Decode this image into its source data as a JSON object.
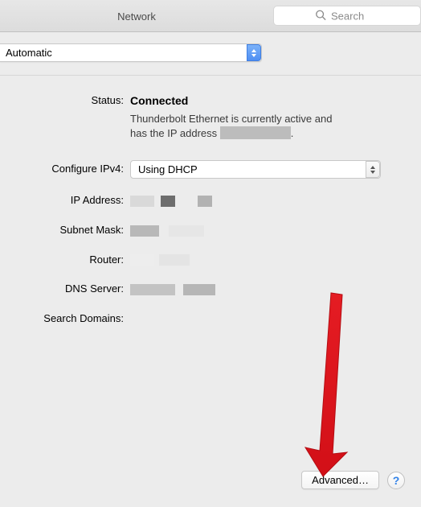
{
  "window": {
    "title": "Network",
    "search": {
      "placeholder": "Search"
    }
  },
  "location": {
    "value": "Automatic"
  },
  "details": {
    "status": {
      "label": "Status:",
      "value": "Connected",
      "desc_line1": "Thunderbolt Ethernet is currently active and",
      "desc_line2_prefix": "has the IP address ",
      "desc_line2_suffix": "."
    },
    "configure_ipv4": {
      "label": "Configure IPv4:",
      "value": "Using DHCP"
    },
    "ip_address": {
      "label": "IP Address:"
    },
    "subnet_mask": {
      "label": "Subnet Mask:"
    },
    "router": {
      "label": "Router:"
    },
    "dns_server": {
      "label": "DNS Server:"
    },
    "search_domains": {
      "label": "Search Domains:"
    }
  },
  "buttons": {
    "advanced": "Advanced…",
    "help": "?"
  },
  "colors": {
    "arrow": "#e51c23"
  }
}
